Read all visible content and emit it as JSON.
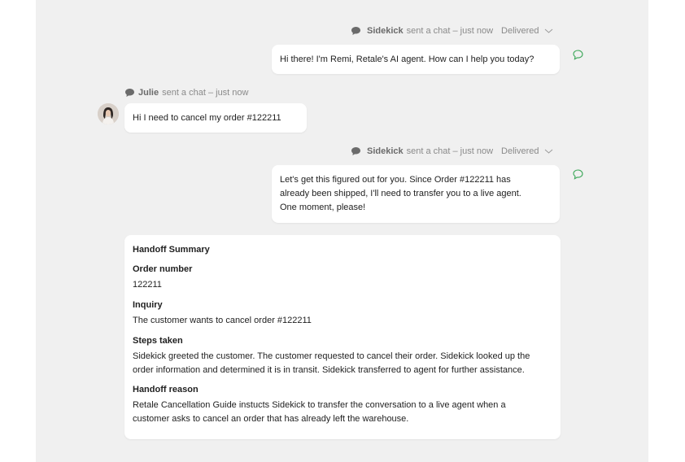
{
  "colors": {
    "panel_bg": "#f0f0f0",
    "accent_green": "#3aa657",
    "meta_gray": "#8a8a8a"
  },
  "messages": [
    {
      "sender": "Sidekick",
      "meta_text": "sent a chat – just now",
      "status": "Delivered",
      "text": "Hi there! I'm Remi, Retale's AI agent. How can I help you today?"
    },
    {
      "sender": "Julie",
      "meta_text": "sent a chat –  just now",
      "text": "Hi I need to cancel my order #122211"
    },
    {
      "sender": "Sidekick",
      "meta_text": "sent a chat – just now",
      "status": "Delivered",
      "lines": [
        "Let's get this figured out for you. Since Order #122211 has",
        "already been shipped, I'll need to transfer you to a live agent.",
        "One moment, please!"
      ]
    }
  ],
  "summary": {
    "title": "Handoff Summary",
    "sections": [
      {
        "heading": "Order number",
        "lines": [
          "122211"
        ]
      },
      {
        "heading": "Inquiry",
        "lines": [
          "The customer wants to cancel order #122211"
        ]
      },
      {
        "heading": "Steps taken",
        "lines": [
          "Sidekick greeted the customer. The customer requested to cancel their order. Sidekick looked up the",
          "order information and determined it is in transit. Sidekick transferred to agent for further assistance."
        ]
      },
      {
        "heading": "Handoff reason",
        "lines": [
          "Retale Cancellation Guide instucts Sidekick to transfer the conversation to a live agent when a",
          "customer asks to cancel an order that has already left the warehouse."
        ]
      }
    ]
  },
  "icons": {
    "chat": "chat-bubble-icon",
    "chevron": "chevron-down-icon",
    "reply": "reply-bubble-icon",
    "avatar": "user-avatar"
  }
}
